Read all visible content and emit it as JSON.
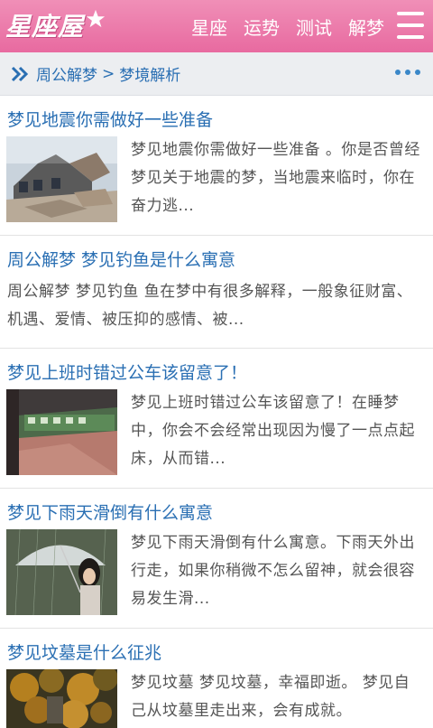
{
  "header": {
    "logo_text": "星座屋",
    "nav": [
      "星座",
      "运势",
      "测试",
      "解梦"
    ],
    "accent": "#ec79aa"
  },
  "breadcrumb": {
    "items": [
      "周公解梦",
      "梦境解析"
    ],
    "separator": ">"
  },
  "articles": [
    {
      "title": "梦见地震你需做好一些准备",
      "summary": "梦见地震你需做好一些准备 。你是否曾经梦见关于地震的梦，当地震来临时，你在奋力逃...",
      "thumbnail": "earthquake-ruins"
    },
    {
      "title": "周公解梦 梦见钓鱼是什么寓意",
      "summary": "周公解梦 梦见钓鱼 鱼在梦中有很多解释，一般象征财富、机遇、爱情、被压抑的感情、被...",
      "thumbnail": ""
    },
    {
      "title": "梦见上班时错过公车该留意了！",
      "summary": "梦见上班时错过公车该留意了！在睡梦中，你会不会经常出现因为慢了一点点起床，从而错...",
      "thumbnail": "train-platform"
    },
    {
      "title": "梦见下雨天滑倒有什么寓意",
      "summary": "梦见下雨天滑倒有什么寓意。下雨天外出行走，如果你稍微不怎么留神，就会很容易发生滑...",
      "thumbnail": "girl-umbrella-rain"
    },
    {
      "title": "梦见坟墓是什么征兆",
      "summary": "梦见坟墓 梦见坟墓，幸福即逝。 梦见自己从坟墓里走出来，会有成就。",
      "thumbnail": "graveyard-autumn"
    }
  ]
}
